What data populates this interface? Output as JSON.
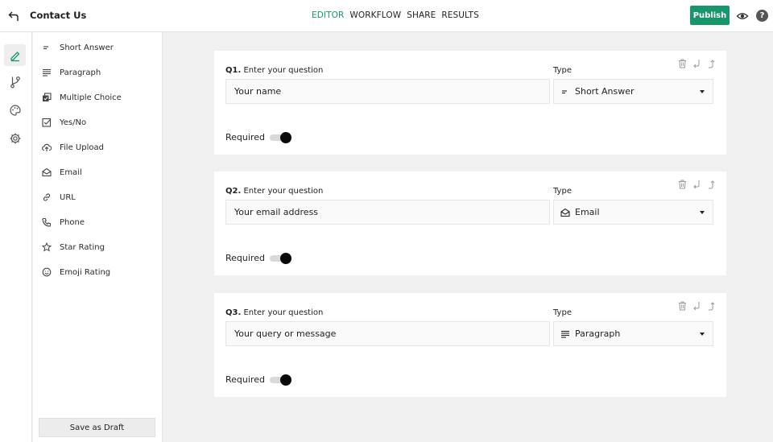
{
  "header": {
    "title": "Contact Us",
    "nav": [
      "EDITOR",
      "WORKFLOW",
      "SHARE",
      "RESULTS"
    ],
    "active_tab": "EDITOR",
    "publish_label": "Publish",
    "help_label": "?"
  },
  "colors": {
    "accent": "#17966a",
    "toggle_on": "#0a0a0a"
  },
  "rail": {
    "items": [
      "pencil-icon",
      "branch-icon",
      "palette-icon",
      "gear-icon"
    ],
    "active": "pencil-icon"
  },
  "fields": {
    "items": [
      {
        "label": "Short Answer",
        "icon": "short-answer-icon"
      },
      {
        "label": "Paragraph",
        "icon": "paragraph-icon"
      },
      {
        "label": "Multiple Choice",
        "icon": "multiple-choice-icon"
      },
      {
        "label": "Yes/No",
        "icon": "checkbox-icon"
      },
      {
        "label": "File Upload",
        "icon": "upload-icon"
      },
      {
        "label": "Email",
        "icon": "email-icon"
      },
      {
        "label": "URL",
        "icon": "link-icon"
      },
      {
        "label": "Phone",
        "icon": "phone-icon"
      },
      {
        "label": "Star Rating",
        "icon": "star-icon"
      },
      {
        "label": "Emoji Rating",
        "icon": "emoji-icon"
      }
    ],
    "draft_label": "Save as Draft"
  },
  "questions": [
    {
      "number": "Q1.",
      "prompt": "Enter your question",
      "type_label": "Type",
      "value": "Your name",
      "type": "Short Answer",
      "type_icon": "short-answer-icon",
      "required_label": "Required",
      "required": true
    },
    {
      "number": "Q2.",
      "prompt": "Enter your question",
      "type_label": "Type",
      "value": "Your email address",
      "type": "Email",
      "type_icon": "email-icon",
      "required_label": "Required",
      "required": true
    },
    {
      "number": "Q3.",
      "prompt": "Enter your question",
      "type_label": "Type",
      "value": "Your query or message",
      "type": "Paragraph",
      "type_icon": "paragraph-icon",
      "required_label": "Required",
      "required": true
    }
  ]
}
